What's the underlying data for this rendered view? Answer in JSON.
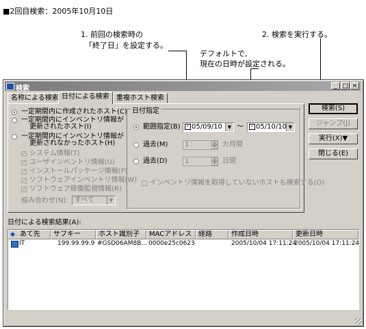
{
  "heading": "■2回目検索：2005年10月10日",
  "annotations": {
    "a1_line1": "1. 前回の検索時の",
    "a1_line2": "「終了日」を設定する。",
    "a2": "2. 検索を実行する。",
    "a3_line1": "デフォルトで,",
    "a3_line2": "現在の日時が設定される。"
  },
  "window": {
    "title": "検索",
    "controls": {
      "minimize": "_",
      "maximize": "□",
      "close": "×"
    }
  },
  "tabs": [
    "名称による検索",
    "日付による検索",
    "重複ホスト検索"
  ],
  "options": {
    "radio1": "一定期間内に作成されたホスト(C)",
    "radio2_line1": "一定期間内にインベントリ情報が",
    "radio2_line2": "更新されたホスト(I)",
    "radio3_line1": "一定期間内にインベントリ情報が",
    "radio3_line2": "更新されなかったホスト(H)",
    "checks": [
      "システム情報(T)",
      "ユーザインベントリ情報(U)",
      "インストールパッケージ情報(P)",
      "ソフトウェアインベントリ情報(W)",
      "ソフトウェア稼働監視情報(R)"
    ],
    "combine_label": "組み合わせ(N):",
    "combine_value": "すべて"
  },
  "date_group": {
    "label": "日付指定",
    "range_label": "範囲指定(B)",
    "from_date": "05/09/10",
    "tilde": "～",
    "to_date": "05/10/10",
    "past_months_label": "過去(M)",
    "past_months_value": "1",
    "months_unit": "カ月間",
    "past_days_label": "過去(D)",
    "past_days_value": "1",
    "days_unit": "日間",
    "uninventoried": "インベントリ情報を取得していないホストも検索する(O)"
  },
  "buttons": {
    "search": "検索(S)",
    "jump": "ジャンプ(J)",
    "execute": "実行(X)▼",
    "close": "閉じる(E)"
  },
  "results": {
    "label": "日付による検索結果(A):",
    "columns": [
      "あて先",
      "サブキー",
      "ホスト識別子",
      "MACアドレス",
      "経路",
      "作成日時",
      "更新日時"
    ],
    "rows": [
      [
        "IT",
        "199.99.99.9",
        "#GSD06AM8B...",
        "0000e25c0623",
        "",
        "2005/10/04 17:11:24",
        "2005/10/04 17:11:24"
      ]
    ]
  }
}
